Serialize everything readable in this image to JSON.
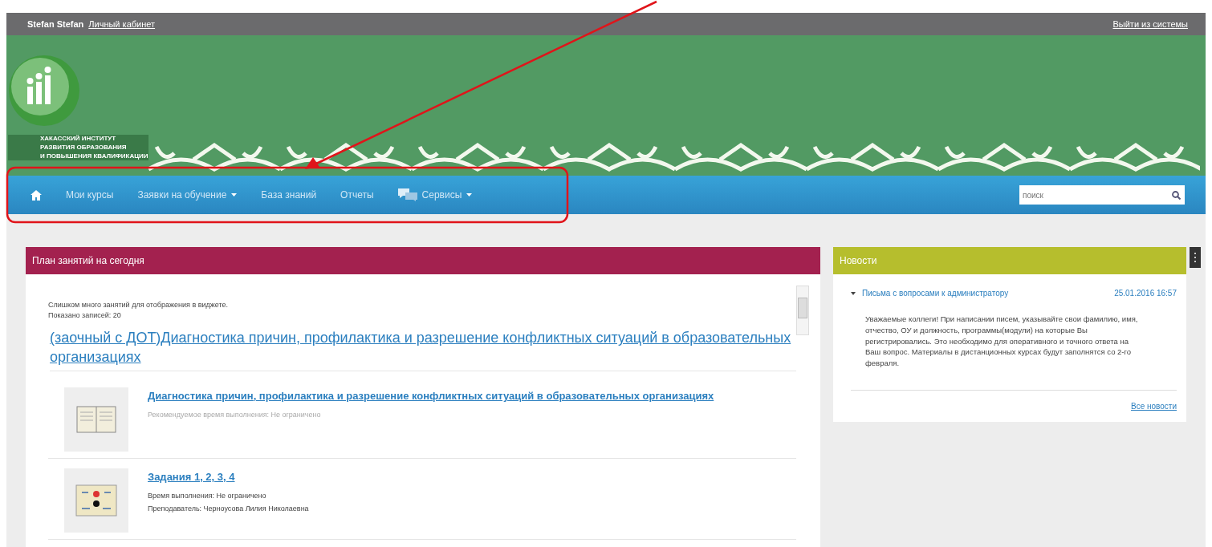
{
  "user_bar": {
    "user_name": "Stefan Stefan",
    "cabinet_link": "Личный кабинет",
    "logout_link": "Выйти из системы"
  },
  "banner": {
    "logo_lines": [
      "ХАКАССКИЙ ИНСТИТУТ",
      "РАЗВИТИЯ ОБРАЗОВАНИЯ",
      "И ПОВЫШЕНИЯ КВАЛИФИКАЦИИ"
    ]
  },
  "nav": {
    "items": [
      {
        "kind": "home",
        "dropdown": false
      },
      {
        "kind": "text",
        "label": "Мои курсы",
        "dropdown": false
      },
      {
        "kind": "text",
        "label": "Заявки на обучение",
        "dropdown": true
      },
      {
        "kind": "text",
        "label": "База знаний",
        "dropdown": false
      },
      {
        "kind": "text",
        "label": "Отчеты",
        "dropdown": false
      },
      {
        "kind": "chat",
        "label": "Сервисы",
        "dropdown": true
      }
    ],
    "search": {
      "placeholder": "поиск"
    }
  },
  "plan": {
    "title": "План занятий на сегодня",
    "notice": [
      "Слишком много занятий для отображения в виджете.",
      "Показано записей: 20"
    ],
    "course_title": "(заочный с ДОТ)Диагностика причин, профилактика и разрешение конфликтных ситуаций в образовательных организациях",
    "activities": [
      {
        "kind": "book",
        "title": "Диагностика причин, профилактика и разрешение конфликтных ситуаций в образовательных организациях",
        "details": [
          {
            "text": "Рекомендуемое время выполнения: Не ограничено",
            "muted": true
          }
        ]
      },
      {
        "kind": "quiz",
        "title": "Задания 1, 2, 3, 4",
        "details": [
          {
            "text": "Время выполнения: Не ограничено",
            "muted": false
          },
          {
            "text": "Преподаватель: Черноусова Лилия Николаевна",
            "muted": false
          }
        ]
      }
    ]
  },
  "news": {
    "title": "Новости",
    "items": [
      {
        "title": "Письма с вопросами к администратору",
        "date": "25.01.2016 16:57",
        "expanded": true,
        "body": "Уважаемые коллеги! При написании писем, указывайте свои фамилию, имя, отчество, ОУ и должность, программы(модули) на которые Вы регистрировались. Это необходимо для оперативного и точного ответа на Ваш вопрос. Материалы в дистанционных курсах будут заполнятся со 2-го февраля."
      }
    ],
    "all_link": "Все новости"
  }
}
